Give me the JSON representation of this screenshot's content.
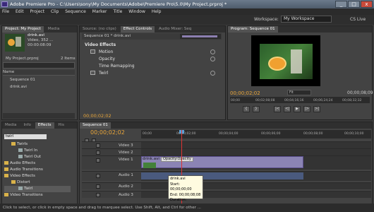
{
  "window": {
    "title": "Adobe Premiere Pro - C:\\Users\\sony\\My Documents\\Adobe\\Premiere Pro\\5.0\\My Project.prproj *",
    "min": "_",
    "max": "□",
    "close": "x"
  },
  "menu": [
    "File",
    "Edit",
    "Project",
    "Clip",
    "Sequence",
    "Marker",
    "Title",
    "Window",
    "Help"
  ],
  "workspace": {
    "label": "Workspace:",
    "value": "My Workspace",
    "cs_live": "CS Live"
  },
  "project_panel": {
    "tabs": [
      "Project: My Project",
      "Media"
    ],
    "clip_name": "drink.avi",
    "clip_info": "Video, 352 ...",
    "clip_duration": "00:00:08:09",
    "project_file": "My Project.prproj",
    "items_count": "2 Items",
    "name_header": "Name",
    "items": [
      "Sequence 01",
      "drink.avi"
    ]
  },
  "effect_controls": {
    "tabs": [
      "Source: (no clips)",
      "Effect Controls",
      "Audio Mixer: Seq"
    ],
    "header": "Sequence 01 * drink.avi",
    "section": "Video Effects",
    "effects": [
      "Motion",
      "Opacity",
      "Time Remapping",
      "Twirl"
    ],
    "timecode": "00;00;02;02"
  },
  "program_monitor": {
    "tab": "Program: Sequence 01",
    "current_time": "00;00;02;02",
    "fit": "Fit",
    "duration": "00;00;08;09",
    "ruler_ticks": [
      "00;00",
      "00;02;08;08",
      "00;04;16;16",
      "00;06;24;24",
      "00;08;32;32"
    ],
    "buttons": [
      "{",
      "}",
      "|<",
      "<|",
      "▶",
      "|>",
      ">|"
    ]
  },
  "effects_panel": {
    "tabs": [
      "Media",
      "Info",
      "Effects",
      "His"
    ],
    "search": "twirl",
    "tree": [
      "Twirls",
      "Twirl In",
      "Twirl Out",
      "Audio Effects",
      "Audio Transitions",
      "Video Effects",
      "Distort",
      "Twirl",
      "Video Transitions"
    ]
  },
  "timeline": {
    "tab": "Sequence 01",
    "timecode": "00;00;02;02",
    "ruler_ticks": [
      "00;00",
      "00;00;02;00",
      "00;00;04;00",
      "00;00;06;00",
      "00;00;08;00",
      "00;00;10;00"
    ],
    "tracks": [
      "Video 3",
      "Video 2",
      "Video 1",
      "Audio 1",
      "Audio 2",
      "Audio 3"
    ],
    "clip_name": "drink.avi",
    "clip_opacity": "Opacity:Opacity",
    "tooltip": {
      "name": "drink.avi",
      "start": "Start: 00;00;00;00",
      "end": "End: 00;00;08;08",
      "duration": "Duration: 00;00;08;09"
    }
  },
  "status": "Click to select, or click in empty space and drag to marquee select. Use Shift, Alt, and Ctrl for other ..."
}
